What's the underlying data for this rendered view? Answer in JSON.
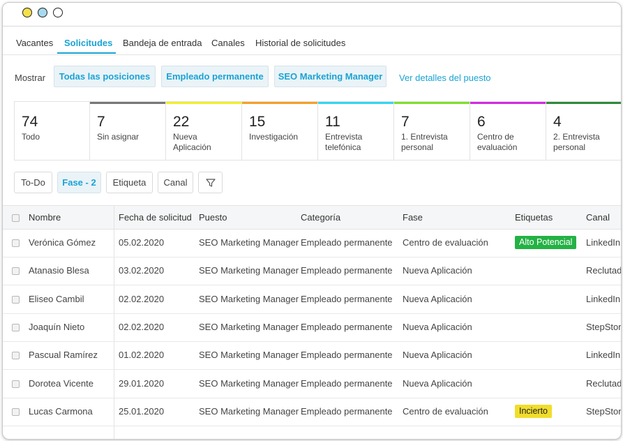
{
  "window": {
    "dots": [
      "#f4e04a",
      "#a6d9ef",
      "#ffffff"
    ]
  },
  "nav": {
    "items": [
      "Vacantes",
      "Solicitudes",
      "Bandeja de entrada",
      "Canales",
      "Historial de solicitudes"
    ],
    "active": "Solicitudes"
  },
  "filters": {
    "show_label": "Mostrar",
    "positions": [
      "Todas las posiciones",
      "Empleado permanente",
      "SEO Marketing Manager"
    ],
    "detail_link": "Ver detalles del puesto"
  },
  "stages": [
    {
      "count": "74",
      "label": "Todo",
      "color": "#ffffff"
    },
    {
      "count": "7",
      "label": "Sin asignar",
      "color": "#777777"
    },
    {
      "count": "22",
      "label": "Nueva Aplicación",
      "color": "#f1ef2b"
    },
    {
      "count": "15",
      "label": "Investigación",
      "color": "#f5a028"
    },
    {
      "count": "11",
      "label": "Entrevista telefónica",
      "color": "#33d6f0"
    },
    {
      "count": "7",
      "label": "1. Entrevista personal",
      "color": "#7ee02a"
    },
    {
      "count": "6",
      "label": "Centro de evaluación",
      "color": "#d22ae0"
    },
    {
      "count": "4",
      "label": "2. Entrevista personal",
      "color": "#2e8a3a"
    }
  ],
  "chips": {
    "todo": "To-Do",
    "fase": "Fase - 2",
    "etiqueta": "Etiqueta",
    "canal": "Canal",
    "filter_icon": "filter-icon"
  },
  "table": {
    "headers": [
      "Nombre",
      "Fecha de solicitud",
      "Puesto",
      "Categoría",
      "Fase",
      "Etiquetas",
      "Canal"
    ],
    "rows": [
      {
        "nombre": "Verónica Gómez",
        "fecha": "05.02.2020",
        "puesto": "SEO Marketing Manager",
        "categoria": "Empleado permanente",
        "fase": "Centro de evaluación",
        "etiqueta": "Alto Potencial",
        "etiqueta_color": "#23b244",
        "canal": "LinkedIn"
      },
      {
        "nombre": "Atanasio Blesa",
        "fecha": "03.02.2020",
        "puesto": "SEO Marketing Manager",
        "categoria": "Empleado permanente",
        "fase": "Nueva Aplicación",
        "etiqueta": "",
        "canal": "Reclutador"
      },
      {
        "nombre": "Eliseo Cambil",
        "fecha": "02.02.2020",
        "puesto": "SEO Marketing Manager",
        "categoria": "Empleado permanente",
        "fase": "Nueva Aplicación",
        "etiqueta": "",
        "canal": "LinkedIn"
      },
      {
        "nombre": "Joaquín Nieto",
        "fecha": "02.02.2020",
        "puesto": "SEO Marketing Manager",
        "categoria": "Empleado permanente",
        "fase": "Nueva Aplicación",
        "etiqueta": "",
        "canal": "StepStone"
      },
      {
        "nombre": "Pascual Ramírez",
        "fecha": "01.02.2020",
        "puesto": "SEO Marketing Manager",
        "categoria": "Empleado permanente",
        "fase": "Nueva Aplicación",
        "etiqueta": "",
        "canal": "LinkedIn"
      },
      {
        "nombre": "Dorotea Vicente",
        "fecha": "29.01.2020",
        "puesto": "SEO Marketing Manager",
        "categoria": "Empleado permanente",
        "fase": "Nueva Aplicación",
        "etiqueta": "",
        "canal": "Reclutador"
      },
      {
        "nombre": "Lucas Carmona",
        "fecha": "25.01.2020",
        "puesto": "SEO Marketing Manager",
        "categoria": "Empleado permanente",
        "fase": "Centro de evaluación",
        "etiqueta": "Incierto",
        "etiqueta_color": "#f1dd2b",
        "canal": "StepStone"
      }
    ]
  }
}
